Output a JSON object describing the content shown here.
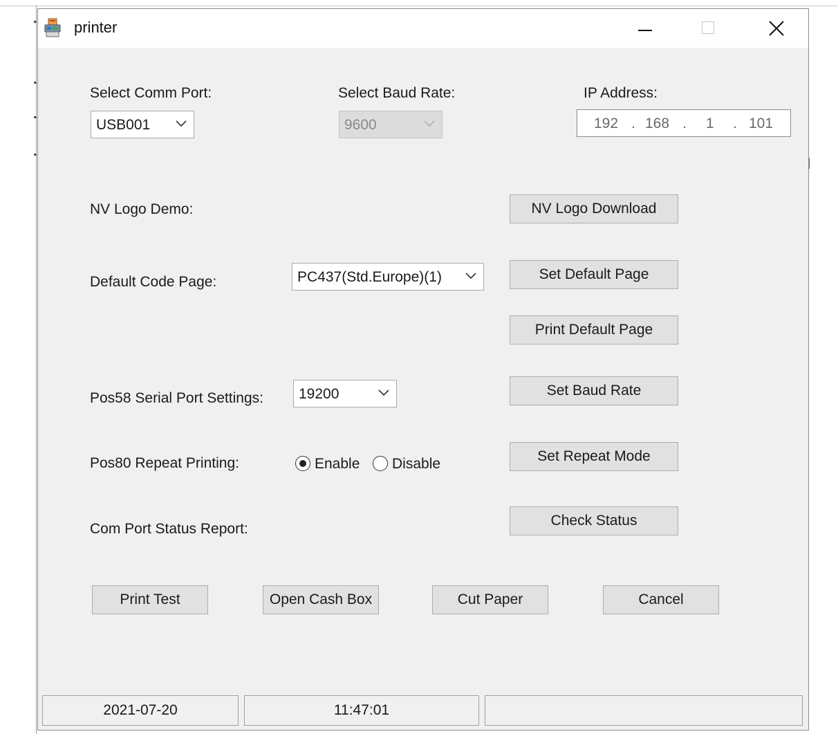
{
  "window": {
    "title": "printer",
    "icon": "printer-app-icon"
  },
  "comm_port": {
    "label": "Select Comm Port:",
    "value": "USB001"
  },
  "baud_rate": {
    "label": "Select Baud Rate:",
    "value": "9600"
  },
  "ip_address": {
    "label": "IP Address:",
    "octets": [
      "192",
      "168",
      "1",
      "101"
    ]
  },
  "nv_logo": {
    "label": "NV Logo Demo:",
    "button": "NV Logo Download"
  },
  "code_page": {
    "label": "Default Code Page:",
    "value": "PC437(Std.Europe)(1)",
    "set_button": "Set Default Page",
    "print_button": "Print Default Page"
  },
  "pos58": {
    "label": "Pos58 Serial Port Settings:",
    "value": "19200",
    "button": "Set Baud Rate"
  },
  "pos80": {
    "label": "Pos80 Repeat Printing:",
    "enable": "Enable",
    "disable": "Disable",
    "selected": "Enable",
    "button": "Set Repeat Mode"
  },
  "status_report": {
    "label": "Com Port Status Report:",
    "button": "Check Status"
  },
  "actions": {
    "print_test": "Print Test",
    "open_cash_box": "Open Cash Box",
    "cut_paper": "Cut Paper",
    "cancel": "Cancel"
  },
  "statusbar": {
    "date": "2021-07-20",
    "time": "11:47:01",
    "message": ""
  }
}
